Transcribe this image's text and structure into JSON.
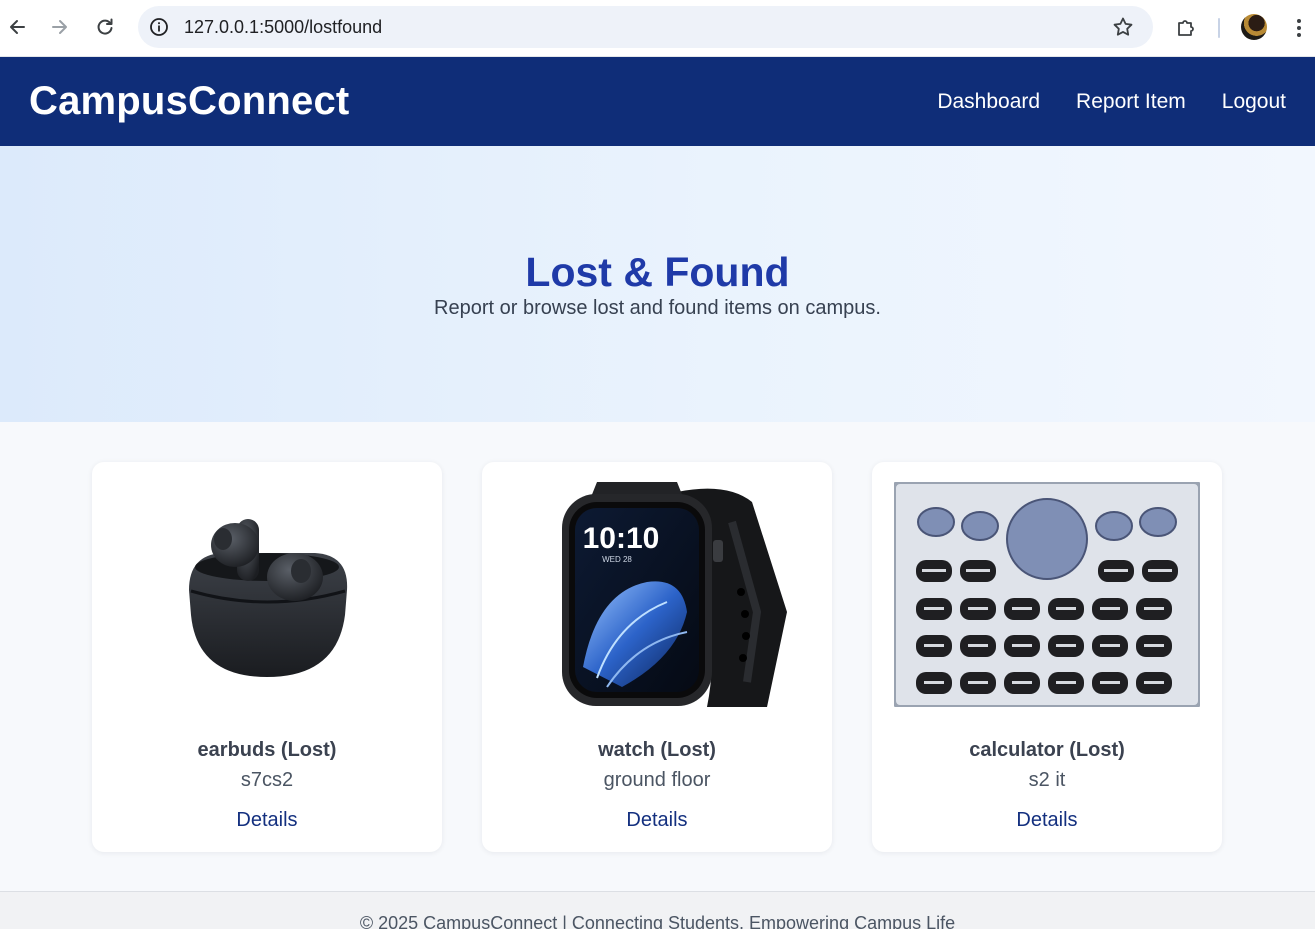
{
  "browser": {
    "url": "127.0.0.1:5000/lostfound",
    "icons": {
      "back": "arrow-left-icon",
      "forward": "arrow-right-icon",
      "reload": "reload-icon",
      "site_info": "info-icon",
      "bookmark": "star-icon",
      "extensions": "puzzle-icon",
      "menu": "kebab-menu-icon"
    }
  },
  "header": {
    "brand": "CampusConnect",
    "nav": [
      "Dashboard",
      "Report Item",
      "Logout"
    ]
  },
  "hero": {
    "title": "Lost & Found",
    "subtitle": "Report or browse lost and found items on campus."
  },
  "items": [
    {
      "title": "earbuds (Lost)",
      "location": "s7cs2",
      "link": "Details",
      "image": "earbuds-image"
    },
    {
      "title": "watch (Lost)",
      "location": "ground floor",
      "link": "Details",
      "image": "smartwatch-image",
      "watch_time": "10:10",
      "watch_date": "WED 28"
    },
    {
      "title": "calculator (Lost)",
      "location": "s2 it",
      "link": "Details",
      "image": "calculator-image"
    }
  ],
  "footer": {
    "text": "© 2025 CampusConnect | Connecting Students, Empowering Campus Life"
  },
  "colors": {
    "header_bg": "#0f2d78",
    "hero_title": "#1f3aa8",
    "link": "#14307f",
    "page_bg": "#f7f9fc"
  }
}
